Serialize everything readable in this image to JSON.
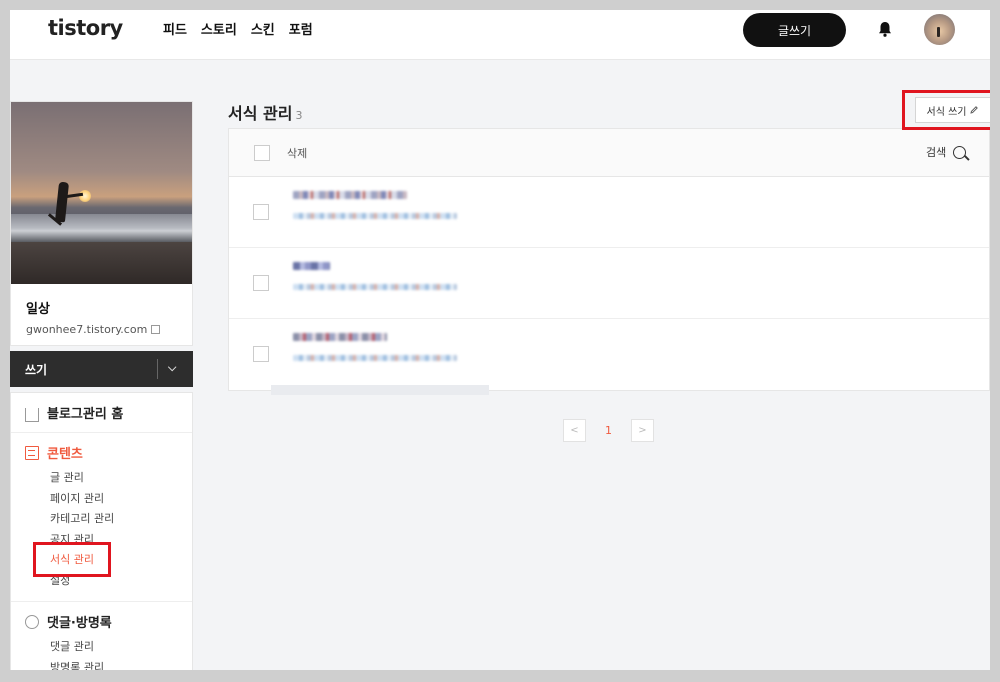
{
  "header": {
    "logo": "tistory",
    "nav": [
      "피드",
      "스토리",
      "스킨",
      "포럼"
    ],
    "write_label": "글쓰기"
  },
  "sidebar": {
    "blog_name": "일상",
    "blog_url": "gwonhee7.tistory.com",
    "write_label": "쓰기",
    "sections": [
      {
        "title": "블로그관리 홈",
        "items": []
      },
      {
        "title": "콘텐츠",
        "items": [
          "글 관리",
          "페이지 관리",
          "카테고리 관리",
          "공지 관리",
          "서식 관리",
          "설정"
        ]
      },
      {
        "title": "댓글·방명록",
        "items": [
          "댓글 관리",
          "방명록 관리"
        ]
      }
    ]
  },
  "main": {
    "title": "서식 관리",
    "count": "3",
    "new_label": "서식 쓰기",
    "delete_label": "삭제",
    "search_label": "검색",
    "page": "1"
  },
  "colors": {
    "accent": "#f05a3f",
    "highlight": "#e0151f",
    "dark": "#2d2d2d"
  }
}
